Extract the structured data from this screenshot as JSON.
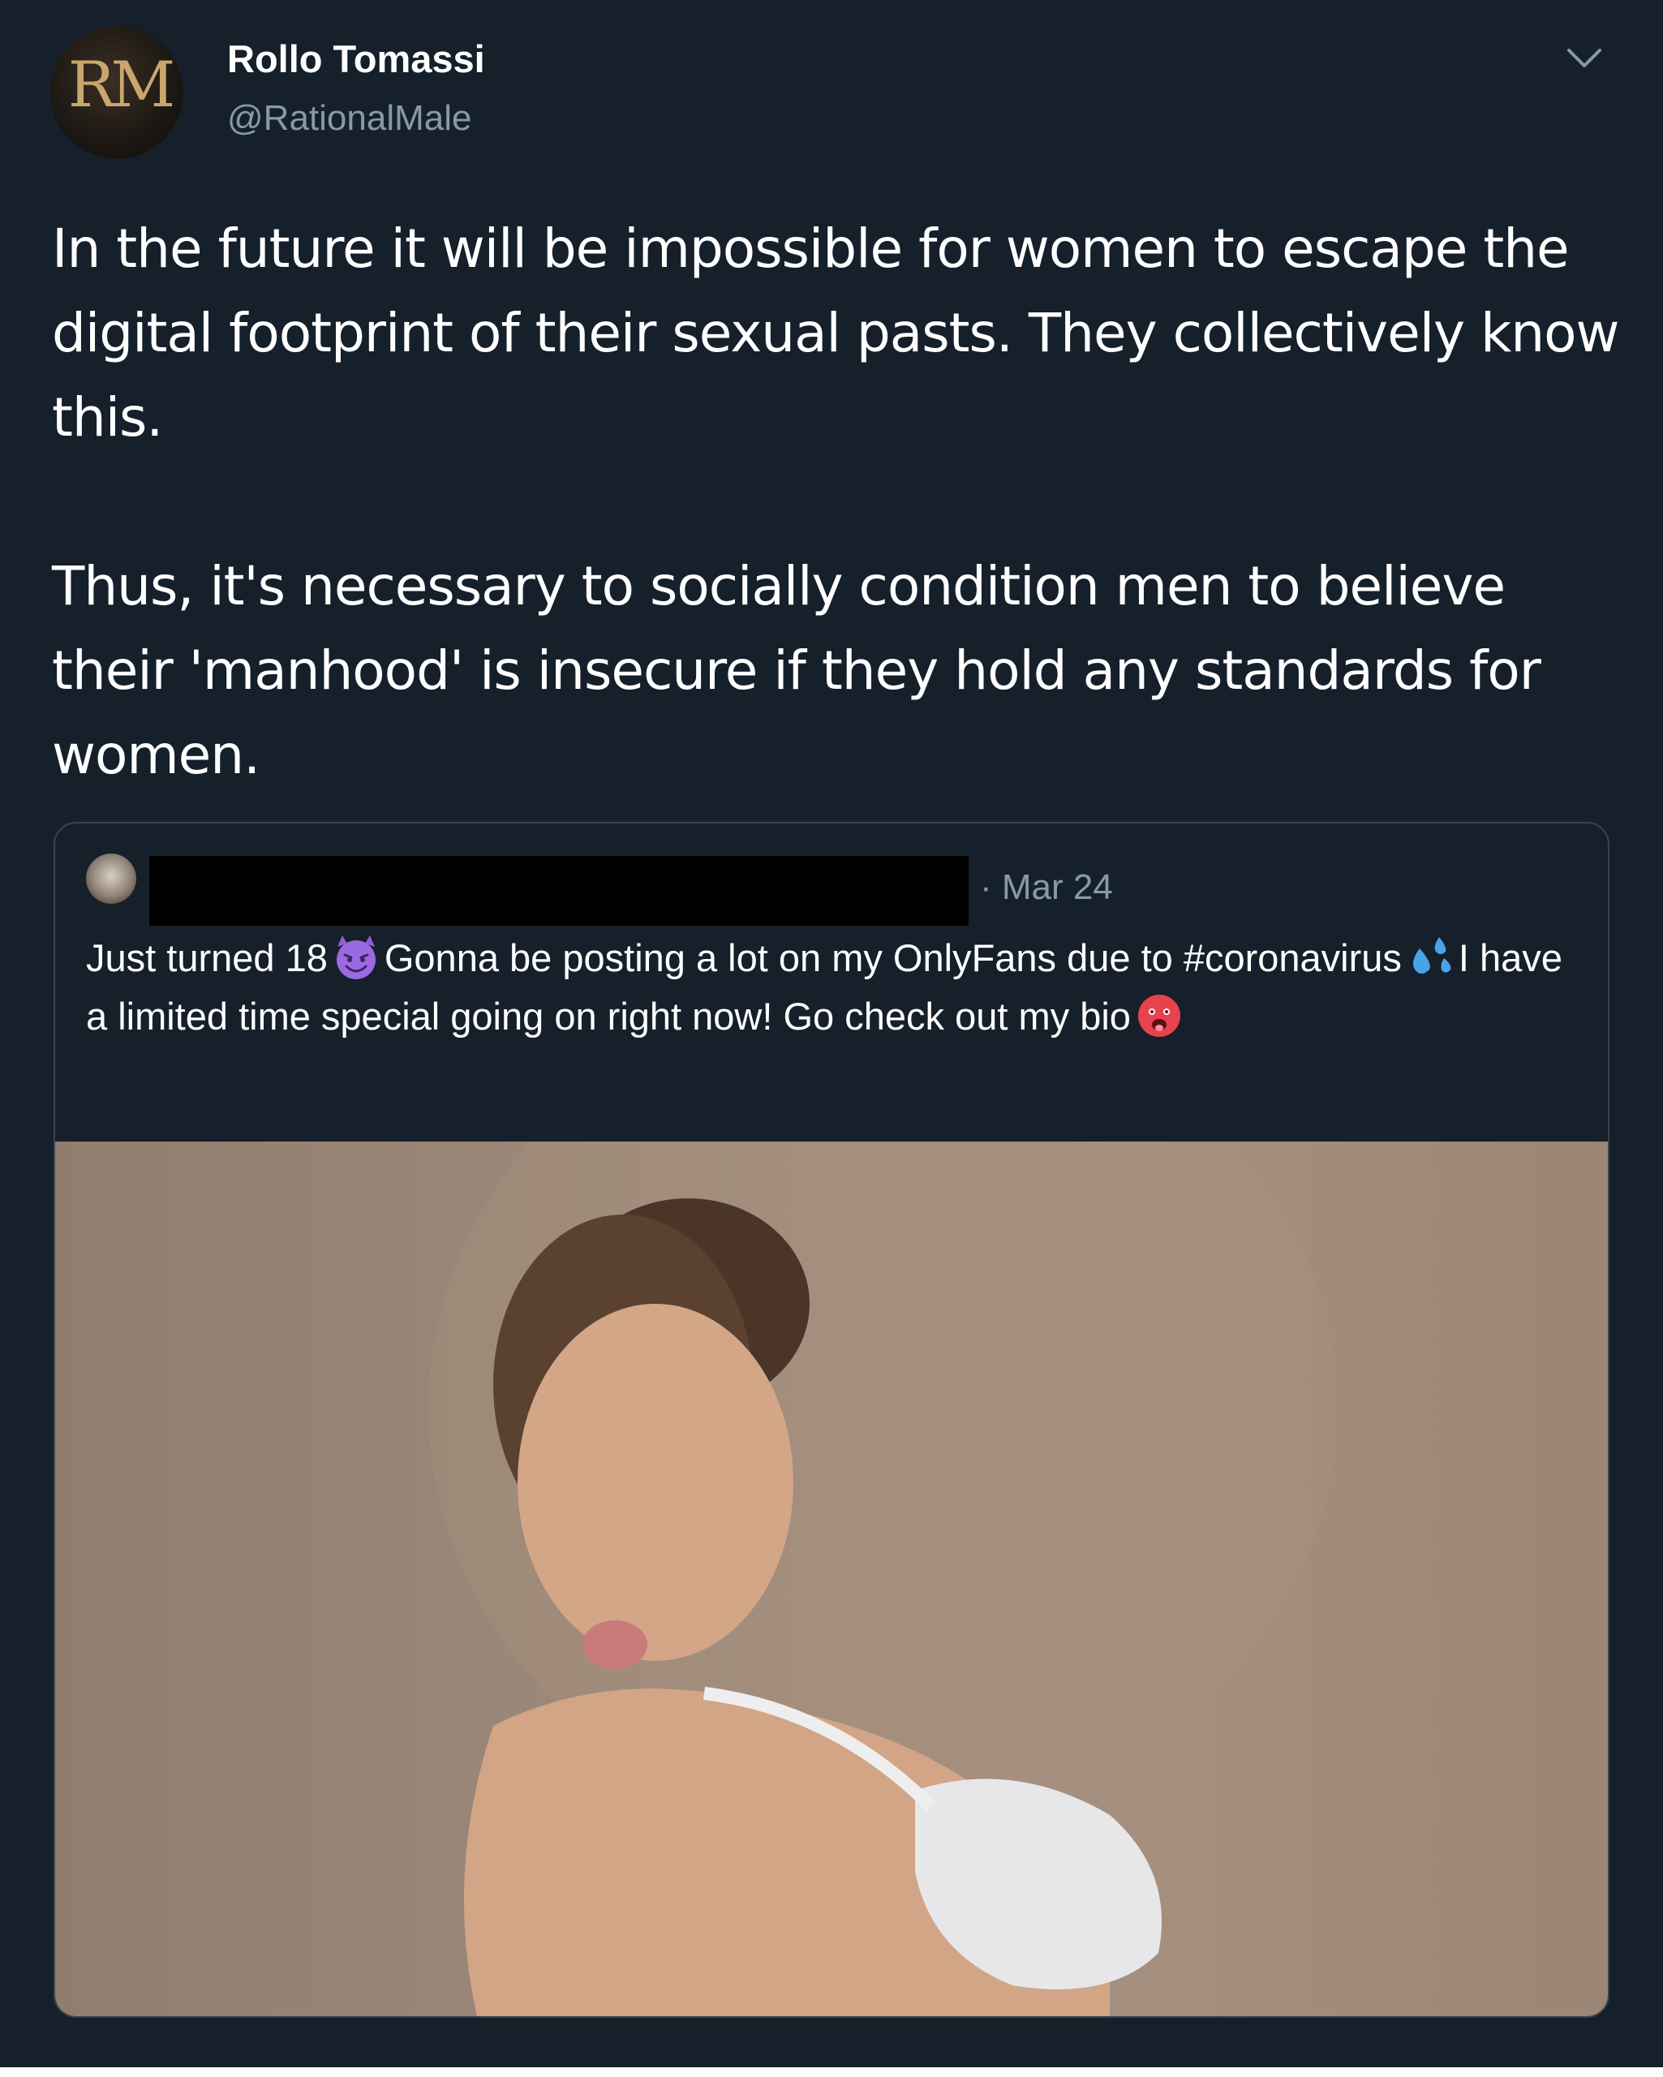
{
  "tweet": {
    "author": {
      "display_name": "Rollo Tomassi",
      "handle": "@RationalMale",
      "avatar_text": "RM"
    },
    "paragraphs": [
      "In the future it will be impossible for women to escape the digital footprint of their sexual pasts. They collectively know this.",
      "Thus, it's necessary to socially condition men to believe their 'manhood' is insecure if they hold any standards for women."
    ],
    "menu_icon": "chevron-down-icon"
  },
  "quoted_tweet": {
    "date": "· Mar 24",
    "text_segments": [
      "Just turned 18",
      "Gonna be posting a lot on my OnlyFans due to #coronavirus",
      "I have a limited time special going on right now! Go check out my bio"
    ],
    "emojis": [
      "smiling-devil-emoji",
      "sweat-droplets-emoji",
      "hot-face-emoji"
    ]
  },
  "colors": {
    "background": "#15202b",
    "text_primary": "#ffffff",
    "text_secondary": "#8899a6",
    "border": "#38444d"
  }
}
